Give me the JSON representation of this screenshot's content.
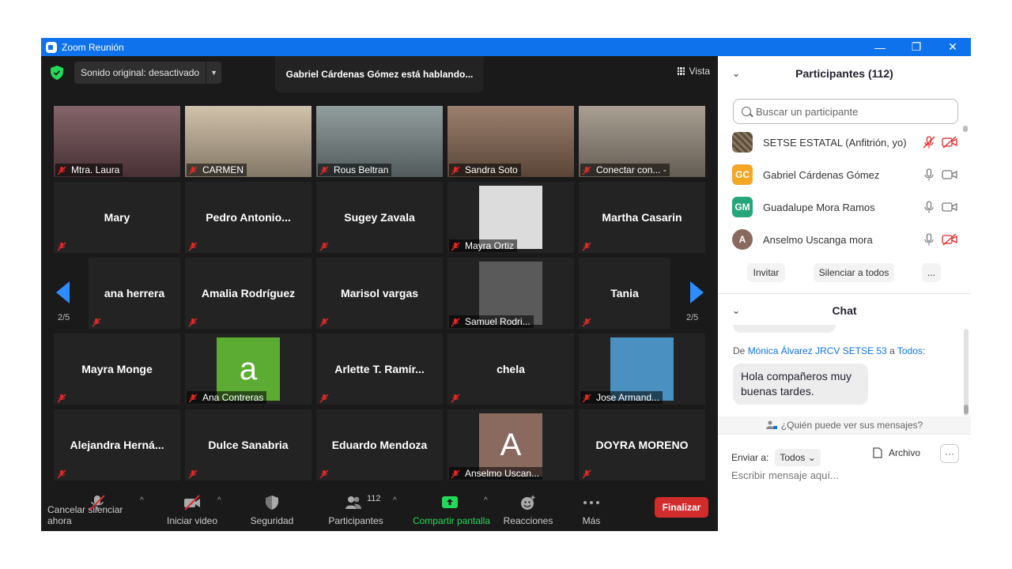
{
  "window": {
    "title": "Zoom Reunión",
    "controls": {
      "minimize": "—",
      "restore": "❐",
      "close": "✕"
    }
  },
  "meeting": {
    "audio_label": "Sonido original: desactivado",
    "speaking_banner": "Gabriel Cárdenas Gómez está hablando...",
    "view_label": "Vista",
    "page_indicator": "2/5",
    "tiles": [
      {
        "label": "Mtra. Laura",
        "type": "video",
        "bg": "#6e4a50"
      },
      {
        "label": "CARMEN",
        "type": "video",
        "bg": "#c9b79c"
      },
      {
        "label": "Rous Beltran",
        "type": "video",
        "bg": "#7f8c8d"
      },
      {
        "label": "Sandra Soto",
        "type": "video",
        "bg": "#8a6a55"
      },
      {
        "label": "Conectar con... -",
        "type": "video",
        "bg": "#9a8f80"
      },
      {
        "name": "Mary",
        "type": "name"
      },
      {
        "name": "Pedro  Antonio...",
        "type": "name"
      },
      {
        "name": "Sugey Zavala",
        "type": "name"
      },
      {
        "label": "Mayra Ortiz",
        "type": "photo",
        "bg": "#dcdcdc"
      },
      {
        "name": "Martha Casarin",
        "type": "name"
      },
      {
        "name": "ana herrera",
        "type": "name"
      },
      {
        "name": "Amalia Rodríguez",
        "type": "name"
      },
      {
        "name": "Marisol vargas",
        "type": "name"
      },
      {
        "label": "Samuel Rodri...",
        "type": "photo",
        "bg": "#5a5a5a"
      },
      {
        "name": "Tania",
        "type": "name"
      },
      {
        "name": "Mayra Monge",
        "type": "name"
      },
      {
        "label": "Ana Contreras",
        "type": "avatar",
        "letter": "a",
        "bg": "#5cac34"
      },
      {
        "name": "Arlette T. Ramír...",
        "type": "name"
      },
      {
        "name": "chela",
        "type": "name"
      },
      {
        "label": "Jose Armand...",
        "type": "photo",
        "bg": "#4a90c0"
      },
      {
        "name": "Alejandra  Herná...",
        "type": "name"
      },
      {
        "name": "Dulce Sanabria",
        "type": "name"
      },
      {
        "name": "Eduardo Mendoza",
        "type": "name"
      },
      {
        "label": "Anselmo Uscan...",
        "type": "avatar",
        "letter": "A",
        "bg": "#8a6a5e"
      },
      {
        "name": "DOYRA MORENO",
        "type": "name"
      }
    ]
  },
  "toolbar": {
    "mute": "Cancelar silenciar ahora",
    "video": "Iniciar video",
    "security": "Seguridad",
    "participants": "Participantes",
    "participants_count": "112",
    "share": "Compartir pantalla",
    "reactions": "Reacciones",
    "more": "Más",
    "end": "Finalizar"
  },
  "participants_panel": {
    "title": "Participantes (112)",
    "search_placeholder": "Buscar un participante",
    "list": [
      {
        "name": "SETSE ESTATAL (Anfitrión, yo)",
        "initials": "",
        "color": "#6b5a48",
        "muted": true,
        "video_off": true
      },
      {
        "name": "Gabriel Cárdenas Gómez",
        "initials": "GC",
        "color": "#f5a623",
        "muted": false,
        "video_off": false
      },
      {
        "name": "Guadalupe Mora Ramos",
        "initials": "GM",
        "color": "#25a57a",
        "muted": false,
        "video_off": false
      },
      {
        "name": "Anselmo Uscanga mora",
        "initials": "A",
        "color": "#8a6a5e",
        "muted": false,
        "video_off": true
      }
    ],
    "invite": "Invitar",
    "mute_all": "Silenciar a todos",
    "more": "..."
  },
  "chat_panel": {
    "title": "Chat",
    "from_prefix": "De",
    "from_name": "Mónica Álvarez JRCV SETSE 53",
    "to_prefix": "a",
    "to_name": "Todos",
    "message": "Hola compañeros muy buenas tardes.",
    "who_can_see": "¿Quién puede ver sus mensajes?",
    "send_to_label": "Enviar a:",
    "send_to_value": "Todos",
    "file_label": "Archivo",
    "more": "···",
    "input_placeholder": "Escribir mensaje aquí..."
  }
}
